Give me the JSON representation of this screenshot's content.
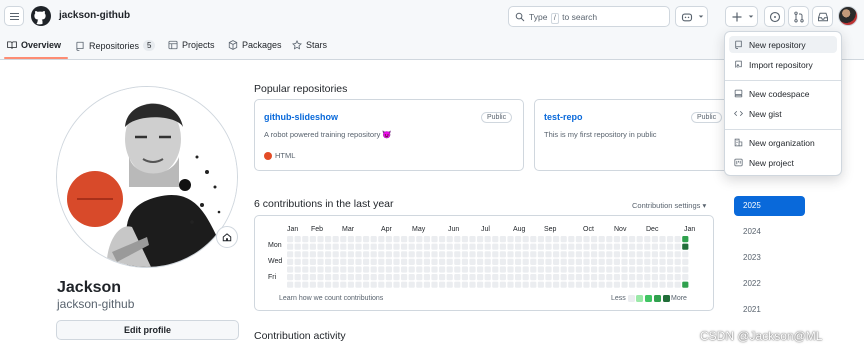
{
  "header": {
    "username": "jackson-github",
    "search_placeholder_pre": "Type",
    "search_key": "/",
    "search_placeholder_post": "to search"
  },
  "tabs": [
    {
      "label": "Overview",
      "icon": "book-icon",
      "active": true
    },
    {
      "label": "Repositories",
      "icon": "repo-icon",
      "count": "5"
    },
    {
      "label": "Projects",
      "icon": "table-icon"
    },
    {
      "label": "Packages",
      "icon": "package-icon"
    },
    {
      "label": "Stars",
      "icon": "star-icon"
    }
  ],
  "profile": {
    "name": "Jackson",
    "login": "jackson-github",
    "edit_label": "Edit profile",
    "status_icon": "home-emoji-icon"
  },
  "popular": {
    "title": "Popular repositories",
    "repos": [
      {
        "name": "github-slideshow",
        "visibility": "Public",
        "description": "A robot powered training repository",
        "desc_emoji": "😈",
        "language": "HTML",
        "language_color": "#e34c26"
      },
      {
        "name": "test-repo",
        "visibility": "Public",
        "description": "This is my first repository in public",
        "language": ""
      }
    ]
  },
  "contributions": {
    "title": "6 contributions in the last year",
    "settings_label": "Contribution settings",
    "months": [
      "Jan",
      "Feb",
      "Mar",
      "Apr",
      "May",
      "Jun",
      "Jul",
      "Aug",
      "Sep",
      "Oct",
      "Nov",
      "Dec",
      "Jan"
    ],
    "day_labels": [
      "Mon",
      "Wed",
      "Fri"
    ],
    "learn_label": "Learn how we count contributions",
    "legend_less": "Less",
    "legend_more": "More",
    "legend_colors": [
      "#ebedf0",
      "#9be9a8",
      "#40c463",
      "#30a14e",
      "#216e39"
    ],
    "active_cells": [
      {
        "week": 52,
        "day": 0,
        "level": 3
      },
      {
        "week": 52,
        "day": 1,
        "level": 4
      },
      {
        "week": 52,
        "day": 6,
        "level": 3
      }
    ]
  },
  "activity": {
    "title": "Contribution activity"
  },
  "years": [
    {
      "label": "2025",
      "active": true
    },
    {
      "label": "2024"
    },
    {
      "label": "2023"
    },
    {
      "label": "2022"
    },
    {
      "label": "2021"
    }
  ],
  "create_menu": {
    "items": [
      {
        "label": "New repository",
        "icon": "repo-icon"
      },
      {
        "label": "Import repository",
        "icon": "repo-push-icon"
      },
      {
        "label": "New codespace",
        "icon": "codespaces-icon"
      },
      {
        "label": "New gist",
        "icon": "code-icon"
      },
      {
        "label": "New organization",
        "icon": "organization-icon"
      },
      {
        "label": "New project",
        "icon": "project-icon"
      }
    ]
  },
  "watermark": "CSDN @Jackson@ML",
  "colors": {
    "accent": "#0969da",
    "tab_underline": "#fd8c73",
    "border": "#d0d7de"
  }
}
